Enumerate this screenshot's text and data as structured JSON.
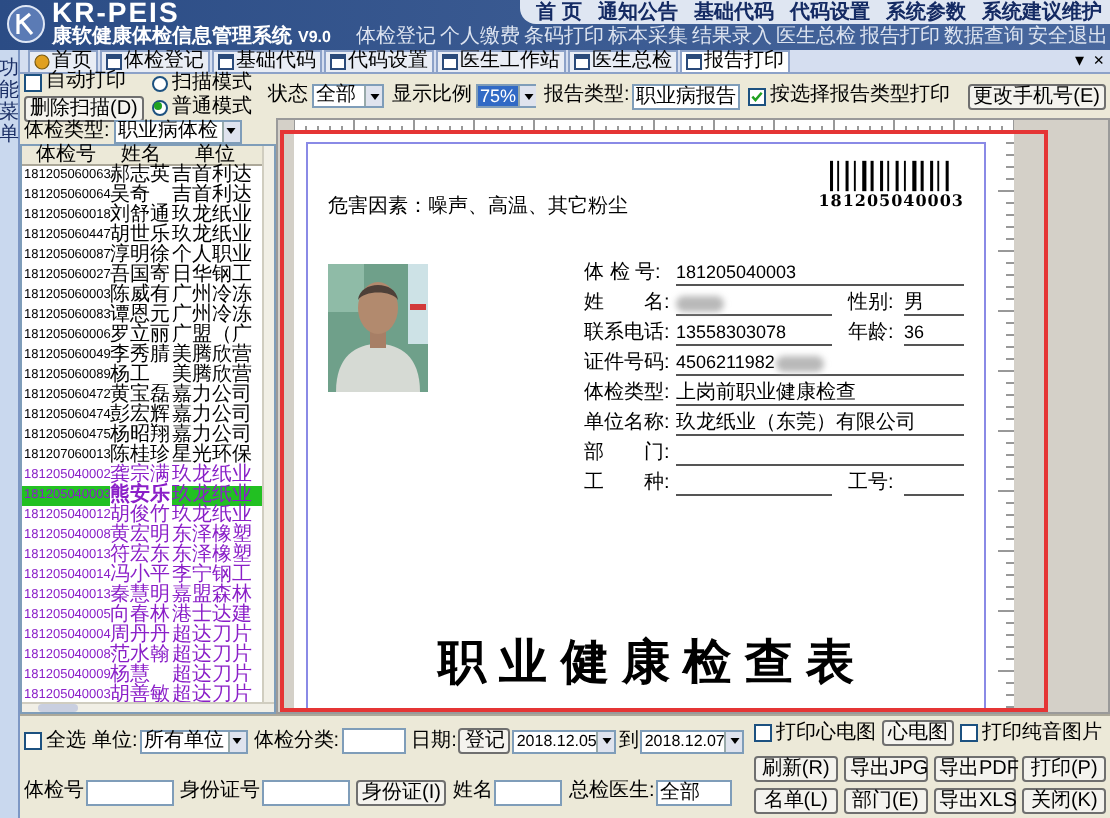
{
  "app": {
    "logo_text": "KR-PEIS",
    "title": "康软健康体检信息管理系统",
    "version": "V9.0"
  },
  "top_nav": [
    "首 页",
    "通知公告",
    "基础代码",
    "代码设置",
    "系统参数",
    "系统建议维护"
  ],
  "quick_links": [
    "体检登记",
    "个人缴费",
    "条码打印",
    "标本采集",
    "结果录入",
    "医生总检",
    "报告打印",
    "数据查询",
    "安全退出"
  ],
  "side_strip": {
    "label": "功能菜单"
  },
  "tabs": [
    {
      "label": "首页",
      "kind": "home",
      "selected": false
    },
    {
      "label": "体检登记",
      "kind": "window",
      "selected": false
    },
    {
      "label": "基础代码",
      "kind": "window",
      "selected": false
    },
    {
      "label": "代码设置",
      "kind": "window",
      "selected": false
    },
    {
      "label": "医生工作站",
      "kind": "window",
      "selected": false
    },
    {
      "label": "医生总检",
      "kind": "window",
      "selected": false
    },
    {
      "label": "报告打印",
      "kind": "window",
      "selected": true
    }
  ],
  "tab_controls": [
    "▾",
    "×"
  ],
  "toolbar": {
    "auto_print": {
      "label": "自动打印",
      "checked": false
    },
    "delete_scan": "删除扫描(D)",
    "modes": [
      {
        "label": "扫描模式",
        "selected": false
      },
      {
        "label": "普通模式",
        "selected": true
      }
    ],
    "status": {
      "label": "状态",
      "value": "全部"
    },
    "zoom": {
      "label": "显示比例",
      "value": "75%"
    },
    "report_type": {
      "label": "报告类型:",
      "value": "职业病报告"
    },
    "filter_by_type": {
      "label": "按选择报告类型打印",
      "checked": true
    },
    "change_phone": "更改手机号(E)"
  },
  "patient_list": {
    "type_filter": {
      "label": "体检类型:",
      "value": "职业病体检"
    },
    "columns": [
      "体检号",
      "姓名",
      "单位"
    ],
    "rows": [
      {
        "id": "181205060063",
        "name": "郝志英",
        "unit": "吉首利达",
        "color": "#000000",
        "selected": false
      },
      {
        "id": "181205060064",
        "name": "吴奇",
        "unit": "吉首利达",
        "color": "#000000",
        "selected": false
      },
      {
        "id": "181205060018",
        "name": "刘舒通",
        "unit": "玖龙纸业",
        "color": "#000000",
        "selected": false
      },
      {
        "id": "181205060447",
        "name": "胡世乐",
        "unit": "玖龙纸业",
        "color": "#000000",
        "selected": false
      },
      {
        "id": "181205060087",
        "name": "淳明徐",
        "unit": "个人职业",
        "color": "#000000",
        "selected": false
      },
      {
        "id": "181205060027",
        "name": "吾国寄",
        "unit": "日华钢工",
        "color": "#000000",
        "selected": false
      },
      {
        "id": "181205060003",
        "name": "陈威有",
        "unit": "广州冷冻",
        "color": "#000000",
        "selected": false
      },
      {
        "id": "181205060083",
        "name": "谭恩元",
        "unit": "广州冷冻",
        "color": "#000000",
        "selected": false
      },
      {
        "id": "181205060006",
        "name": "罗立丽",
        "unit": "广盟（广",
        "color": "#000000",
        "selected": false
      },
      {
        "id": "181205060049",
        "name": "李秀腈",
        "unit": "美腾欣营",
        "color": "#000000",
        "selected": false
      },
      {
        "id": "181205060089",
        "name": "杨工",
        "unit": "美腾欣营",
        "color": "#000000",
        "selected": false
      },
      {
        "id": "181205060472",
        "name": "黄宝磊",
        "unit": "嘉力公司",
        "color": "#000000",
        "selected": false
      },
      {
        "id": "181205060474",
        "name": "彭宏辉",
        "unit": "嘉力公司",
        "color": "#000000",
        "selected": false
      },
      {
        "id": "181205060475",
        "name": "杨昭翔",
        "unit": "嘉力公司",
        "color": "#000000",
        "selected": false
      },
      {
        "id": "181207060013",
        "name": "陈桂珍",
        "unit": "星光环保",
        "color": "#000000",
        "selected": false
      },
      {
        "id": "181205040002",
        "name": "龚宗满",
        "unit": "玖龙纸业",
        "color": "#8a1fc8",
        "selected": false
      },
      {
        "id": "181205040003",
        "name": "熊安乐",
        "unit": "玖龙纸业",
        "color": "#8a1fc8",
        "selected": true
      },
      {
        "id": "181205040012",
        "name": "胡俊竹",
        "unit": "玖龙纸业",
        "color": "#8a1fc8",
        "selected": false
      },
      {
        "id": "181205040008",
        "name": "黄宏明",
        "unit": "东泽橡塑",
        "color": "#8a1fc8",
        "selected": false
      },
      {
        "id": "181205040013",
        "name": "符宏东",
        "unit": "东泽橡塑",
        "color": "#8a1fc8",
        "selected": false
      },
      {
        "id": "181205040014",
        "name": "冯小平",
        "unit": "李宁钢工",
        "color": "#8a1fc8",
        "selected": false
      },
      {
        "id": "181205040013",
        "name": "秦慧明",
        "unit": "嘉盟森林",
        "color": "#8a1fc8",
        "selected": false
      },
      {
        "id": "181205040005",
        "name": "向春林",
        "unit": "港士达建",
        "color": "#8a1fc8",
        "selected": false
      },
      {
        "id": "181205040004",
        "name": "周丹丹",
        "unit": "超达刀片",
        "color": "#8a1fc8",
        "selected": false
      },
      {
        "id": "181205040008",
        "name": "范水翰",
        "unit": "超达刀片",
        "color": "#8a1fc8",
        "selected": false
      },
      {
        "id": "181205040009",
        "name": "杨慧",
        "unit": "超达刀片",
        "color": "#8a1fc8",
        "selected": false
      },
      {
        "id": "181205040003",
        "name": "胡善敏",
        "unit": "超达刀片",
        "color": "#8a1fc8",
        "selected": false
      }
    ]
  },
  "report": {
    "hazards": "危害因素：噪声、高温、其它粉尘",
    "barcode": "181205040003",
    "lines": [
      {
        "fields": [
          {
            "label": "体 检 号:",
            "value": "181205040003"
          }
        ]
      },
      {
        "fields": [
          {
            "label": "姓　　名:",
            "redacted": true
          },
          {
            "label": "性别:",
            "value": "男"
          }
        ]
      },
      {
        "fields": [
          {
            "label": "联系电话:",
            "value": "13558303078"
          },
          {
            "label": "年龄:",
            "value": "36"
          }
        ]
      },
      {
        "fields": [
          {
            "label": "证件号码:",
            "value": "4506211982",
            "redacted": true
          }
        ]
      },
      {
        "fields": [
          {
            "label": "体检类型:",
            "value": "上岗前职业健康检查"
          }
        ]
      },
      {
        "fields": [
          {
            "label": "单位名称:",
            "value": "玖龙纸业（东莞）有限公司"
          }
        ]
      },
      {
        "fields": [
          {
            "label": "部　　门:"
          }
        ]
      },
      {
        "fields": [
          {
            "label": "工　　种:"
          },
          {
            "label": "工号:"
          }
        ]
      }
    ],
    "title": "职 业 健 康 检 查 表"
  },
  "bottom": {
    "select_all": {
      "label": "全选",
      "checked": false
    },
    "unit": {
      "label": "单位:",
      "value": "所有单位"
    },
    "exam_category": {
      "label": "体检分类:"
    },
    "date": {
      "label": "日期:",
      "basis": "登记",
      "from": "2018.12.05",
      "to_label": "到",
      "to": "2018.12.07"
    },
    "exam_no": {
      "label": "体检号"
    },
    "id_no": {
      "label": "身份证号"
    },
    "id_card_button": "身份证(I)",
    "name": {
      "label": "姓名"
    },
    "doctor": {
      "label": "总检医生:",
      "value": "全部"
    },
    "ecg": {
      "label": "打印心电图",
      "checked": false
    },
    "ecg_button": "心电图",
    "audio": {
      "label": "打印纯音图片",
      "checked": false
    },
    "buttons": [
      "刷新(R)",
      "导出JPG",
      "导出PDF",
      "打印(P)",
      "名单(L)",
      "部门(E)",
      "导出XLS",
      "关闭(K)"
    ]
  }
}
